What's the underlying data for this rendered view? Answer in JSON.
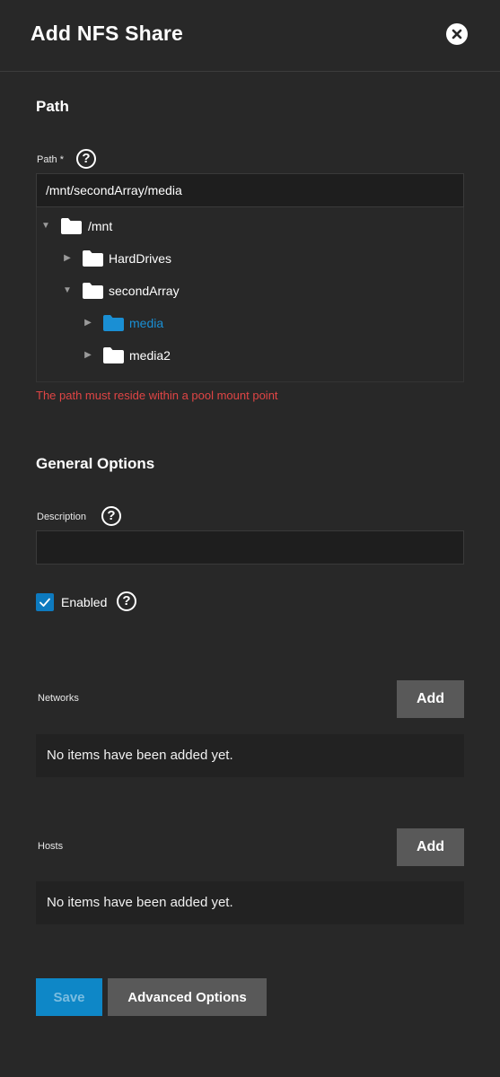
{
  "dialog": {
    "title": "Add NFS Share"
  },
  "path_section": {
    "title": "Path",
    "label": "Path",
    "required_mark": "*",
    "help": "?",
    "value": "/mnt/secondArray/media",
    "tree": [
      {
        "toggle": "▼",
        "label": "/mnt",
        "selected": false
      },
      {
        "toggle": "▶",
        "label": "HardDrives",
        "selected": false
      },
      {
        "toggle": "▼",
        "label": "secondArray",
        "selected": false
      },
      {
        "toggle": "▶",
        "label": "media",
        "selected": true
      },
      {
        "toggle": "▶",
        "label": "media2",
        "selected": false
      }
    ],
    "error": "The path must reside within a pool mount point"
  },
  "general_section": {
    "title": "General Options",
    "description_label": "Description",
    "description_value": "",
    "help": "?",
    "enabled_label": "Enabled",
    "enabled": true
  },
  "networks": {
    "label": "Networks",
    "add_label": "Add",
    "empty": "No items have been added yet."
  },
  "hosts": {
    "label": "Hosts",
    "add_label": "Add",
    "empty": "No items have been added yet."
  },
  "actions": {
    "save_label": "Save",
    "advanced_label": "Advanced Options"
  },
  "colors": {
    "background": "#282828",
    "accent": "#0e87c7",
    "selected_folder": "#1a8fd4",
    "error": "#e04545",
    "button": "#595959"
  }
}
